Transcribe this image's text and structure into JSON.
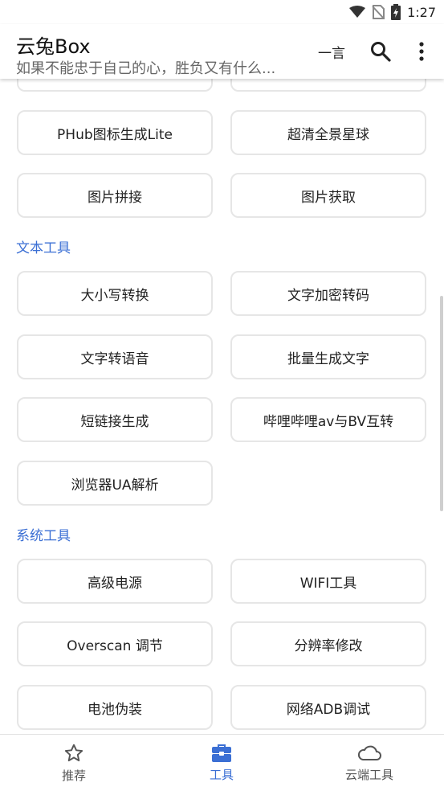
{
  "status_bar": {
    "time": "1:27"
  },
  "app_bar": {
    "title": "云兔Box",
    "subtitle": "如果不能忠于自己的心，胜负又有什么...",
    "yiyan_label": "一言"
  },
  "sections": {
    "image_tools": {
      "items": [
        "PHub图标生成Lite",
        "超清全景星球",
        "图片拼接",
        "图片获取"
      ]
    },
    "text_tools": {
      "title": "文本工具",
      "items": [
        "大小写转换",
        "文字加密转码",
        "文字转语音",
        "批量生成文字",
        "短链接生成",
        "哔哩哔哩av与BV互转",
        "浏览器UA解析"
      ]
    },
    "system_tools": {
      "title": "系统工具",
      "items": [
        "高级电源",
        "WIFI工具",
        "Overscan 调节",
        "分辨率修改",
        "电池伪装",
        "网络ADB调试"
      ]
    }
  },
  "bottom_nav": {
    "items": [
      {
        "label": "推荐",
        "icon": "star-icon"
      },
      {
        "label": "工具",
        "icon": "toolbox-icon"
      },
      {
        "label": "云端工具",
        "icon": "cloud-icon"
      }
    ],
    "active_index": 1
  },
  "colors": {
    "accent": "#3b6fd4"
  }
}
